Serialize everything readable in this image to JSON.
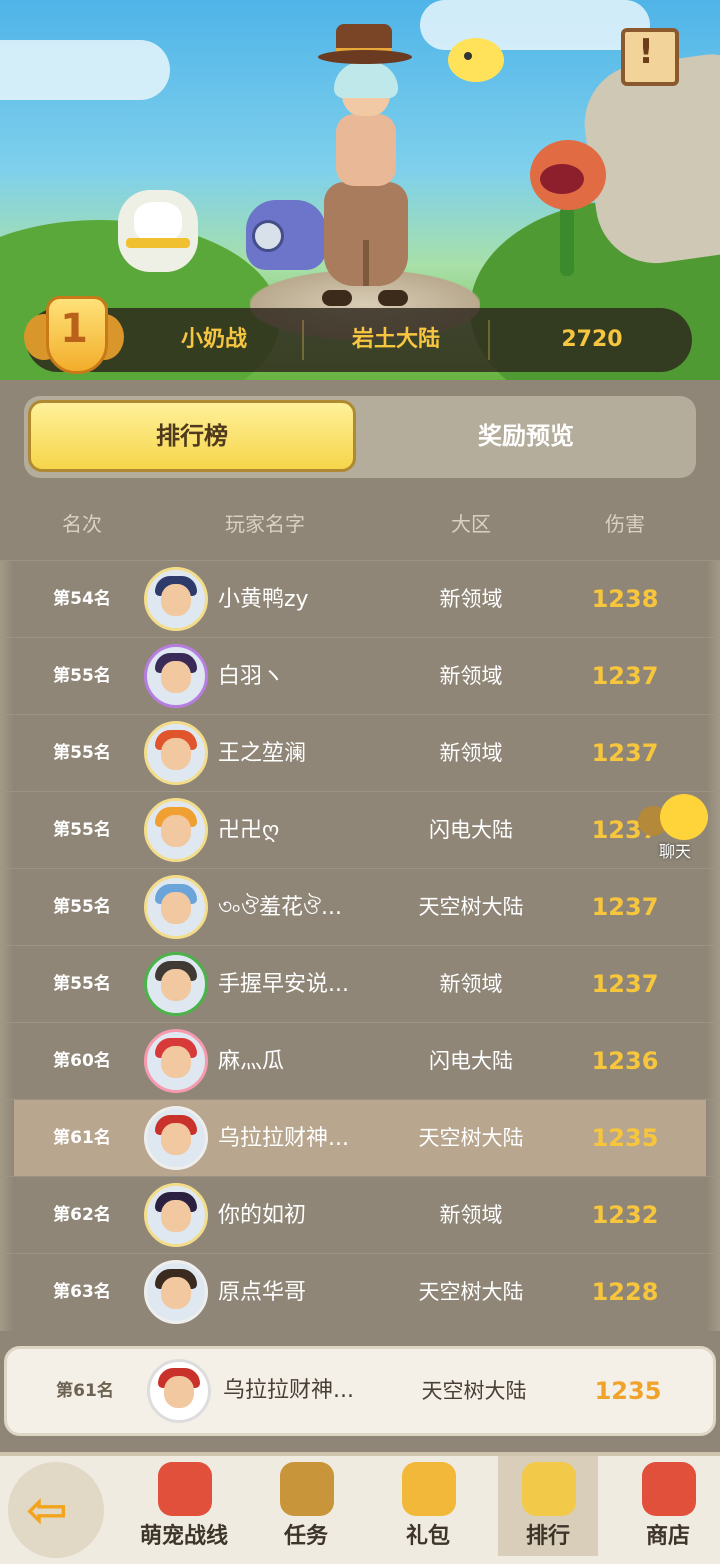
{
  "hero": {
    "top_player": {
      "rank": "1",
      "name": "小奶战",
      "zone": "岩土大陆",
      "damage": "2720"
    },
    "notice_icon": "notice-scroll-icon"
  },
  "tabs": [
    {
      "label": "排行榜",
      "active": true
    },
    {
      "label": "奖励预览",
      "active": false
    }
  ],
  "columns": [
    "名次",
    "玩家名字",
    "大区",
    "伤害"
  ],
  "rows": [
    {
      "rank": "第54名",
      "name": "小黄鸭zy",
      "zone": "新领域",
      "damage": "1238",
      "hair": "#2d3a6a",
      "ring": "#f3dd8a"
    },
    {
      "rank": "第55名",
      "name": "白羽ヽ",
      "zone": "新领域",
      "damage": "1237",
      "hair": "#3a2a58",
      "ring": "#b77de0"
    },
    {
      "rank": "第55名",
      "name": "王之堃澜",
      "zone": "新领域",
      "damage": "1237",
      "hair": "#e0552c",
      "ring": "#f3dd8a"
    },
    {
      "rank": "第55名",
      "name": "卍卍ღ",
      "zone": "闪电大陆",
      "damage": "1237",
      "hair": "#f0a030",
      "ring": "#f3dd8a"
    },
    {
      "rank": "第55名",
      "name": "৩৹ঔ羞花ঔ...",
      "zone": "天空树大陆",
      "damage": "1237",
      "hair": "#6aa4d8",
      "ring": "#f3dd8a"
    },
    {
      "rank": "第55名",
      "name": "手握早安说...",
      "zone": "新领域",
      "damage": "1237",
      "hair": "#3f3a34",
      "ring": "#4cb34a"
    },
    {
      "rank": "第60名",
      "name": "麻灬瓜",
      "zone": "闪电大陆",
      "damage": "1236",
      "hair": "#d83a3a",
      "ring": "#f79ab0"
    },
    {
      "rank": "第61名",
      "name": "乌拉拉财神...",
      "zone": "天空树大陆",
      "damage": "1235",
      "hair": "#c9322b",
      "ring": "#eeeeee",
      "self": true
    },
    {
      "rank": "第62名",
      "name": "你的如初",
      "zone": "新领域",
      "damage": "1232",
      "hair": "#2c2040",
      "ring": "#f3dd8a"
    },
    {
      "rank": "第63名",
      "name": "原点华哥",
      "zone": "天空树大陆",
      "damage": "1228",
      "hair": "#3a2a20",
      "ring": "#eeeeee"
    }
  ],
  "my_rank": {
    "rank": "第61名",
    "name": "乌拉拉财神...",
    "zone": "天空树大陆",
    "damage": "1235"
  },
  "chat": {
    "label": "聊天"
  },
  "nav": {
    "back_icon": "back-arrow-icon",
    "items": [
      {
        "label": "萌宠战线",
        "icon": "pet-battle-icon",
        "color": "#e0503a",
        "active": false
      },
      {
        "label": "任务",
        "icon": "task-icon",
        "color": "#c8953a",
        "active": false
      },
      {
        "label": "礼包",
        "icon": "gift-icon",
        "color": "#f2b83a",
        "active": false
      },
      {
        "label": "排行",
        "icon": "podium-icon",
        "color": "#f3c94a",
        "active": true
      },
      {
        "label": "商店",
        "icon": "shop-icon",
        "color": "#e0503a",
        "active": false
      }
    ]
  }
}
